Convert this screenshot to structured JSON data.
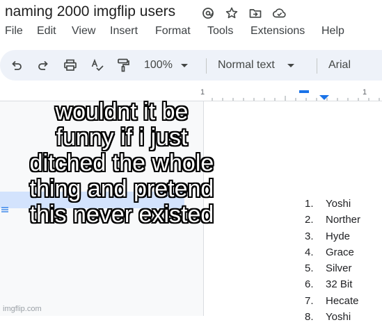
{
  "document": {
    "title": "naming 2000 imgflip users"
  },
  "menu": [
    "File",
    "Edit",
    "View",
    "Insert",
    "Format",
    "Tools",
    "Extensions",
    "Help"
  ],
  "toolbar": {
    "zoom": "100%",
    "style": "Normal text",
    "font": "Arial"
  },
  "ruler": {
    "left_label": "1",
    "right_label": "1"
  },
  "overlay_text": [
    "wouldnt it be",
    "funny if i just",
    "ditched the whole",
    "thing and pretend",
    "this never existed"
  ],
  "users": [
    {
      "num": "1.",
      "name": "Yoshi"
    },
    {
      "num": "2.",
      "name": "Norther"
    },
    {
      "num": "3.",
      "name": "Hyde"
    },
    {
      "num": "4.",
      "name": "Grace"
    },
    {
      "num": "5.",
      "name": "Silver"
    },
    {
      "num": "6.",
      "name": "32 Bit"
    },
    {
      "num": "7.",
      "name": "Hecate"
    },
    {
      "num": "8.",
      "name": "Yoshi"
    }
  ],
  "watermark": "imgflip.com",
  "colors": {
    "accent": "#1a73e8",
    "toolbar_bg": "#eef2f9",
    "selection": "#d3e3fd"
  }
}
